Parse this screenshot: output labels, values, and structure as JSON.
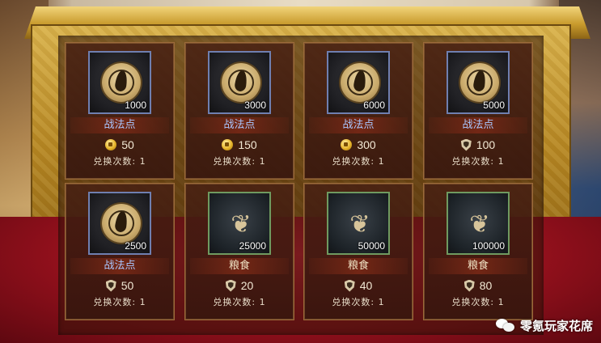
{
  "shop": {
    "items": [
      {
        "name": "战法点",
        "quantity": "1000",
        "price": "50",
        "currency": "coin-icon",
        "limit": "兑换次数: 1",
        "icon": "tactic-point-icon",
        "frame": "blue"
      },
      {
        "name": "战法点",
        "quantity": "3000",
        "price": "150",
        "currency": "coin-icon",
        "limit": "兑换次数: 1",
        "icon": "tactic-point-icon",
        "frame": "blue"
      },
      {
        "name": "战法点",
        "quantity": "6000",
        "price": "300",
        "currency": "coin-icon",
        "limit": "兑换次数: 1",
        "icon": "tactic-point-icon",
        "frame": "blue"
      },
      {
        "name": "战法点",
        "quantity": "5000",
        "price": "100",
        "currency": "shield-icon",
        "limit": "兑换次数: 1",
        "icon": "tactic-point-icon",
        "frame": "blue"
      },
      {
        "name": "战法点",
        "quantity": "2500",
        "price": "50",
        "currency": "shield-icon",
        "limit": "兑换次数: 1",
        "icon": "tactic-point-icon",
        "frame": "blue"
      },
      {
        "name": "粮食",
        "quantity": "25000",
        "price": "20",
        "currency": "shield-icon",
        "limit": "兑换次数: 1",
        "icon": "grain-icon",
        "frame": "green"
      },
      {
        "name": "粮食",
        "quantity": "50000",
        "price": "40",
        "currency": "shield-icon",
        "limit": "兑换次数: 1",
        "icon": "grain-icon",
        "frame": "green"
      },
      {
        "name": "粮食",
        "quantity": "100000",
        "price": "80",
        "currency": "shield-icon",
        "limit": "兑换次数: 1",
        "icon": "grain-icon",
        "frame": "green"
      }
    ]
  },
  "watermark": {
    "text": "零氪玩家花席",
    "icon": "wechat-icon"
  },
  "colors": {
    "tactic_name": "#a9c7ff",
    "food_name": "#efe2c4",
    "gold": "#c89a2c",
    "cloth": "#a0121f"
  }
}
